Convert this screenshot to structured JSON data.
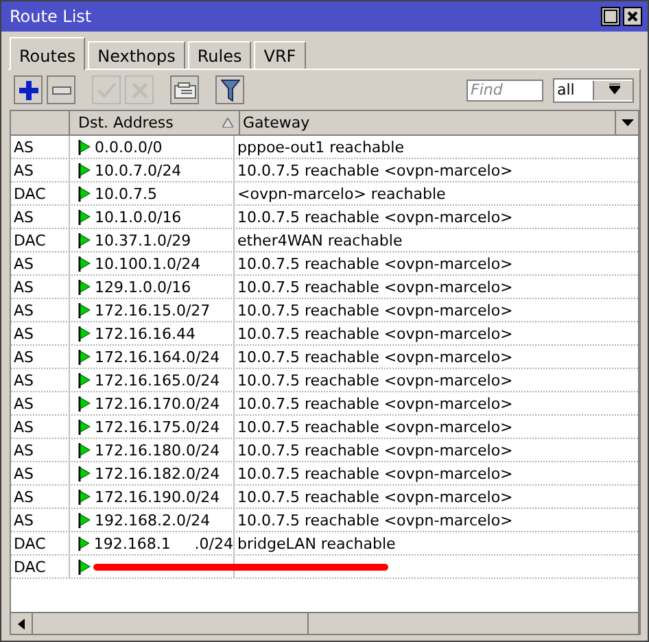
{
  "window": {
    "title": "Route List"
  },
  "tabs": [
    {
      "label": "Routes",
      "selected": true
    },
    {
      "label": "Nexthops",
      "selected": false
    },
    {
      "label": "Rules",
      "selected": false
    },
    {
      "label": "VRF",
      "selected": false
    }
  ],
  "toolbar": {
    "buttons": [
      {
        "kind": "add",
        "disabled": false
      },
      {
        "kind": "remove",
        "disabled": false
      },
      {
        "kind": "enable",
        "disabled": true
      },
      {
        "kind": "disable",
        "disabled": true
      },
      {
        "kind": "comment",
        "disabled": false
      },
      {
        "kind": "filter",
        "disabled": false
      }
    ],
    "search": {
      "placeholder": "Find"
    },
    "filter_select": {
      "value": "all"
    }
  },
  "table": {
    "columns": [
      {
        "label": "Dst. Address"
      },
      {
        "label": "Gateway"
      }
    ],
    "rows": [
      {
        "type": "AS",
        "dst": "0.0.0.0/0",
        "gateway": "pppoe-out1 reachable"
      },
      {
        "type": "AS",
        "dst": "10.0.7.0/24",
        "gateway": "10.0.7.5 reachable <ovpn-marcelo>"
      },
      {
        "type": "DAC",
        "dst": "10.0.7.5",
        "gateway": "<ovpn-marcelo> reachable"
      },
      {
        "type": "AS",
        "dst": "10.1.0.0/16",
        "gateway": "10.0.7.5 reachable <ovpn-marcelo>"
      },
      {
        "type": "DAC",
        "dst": "10.37.1.0/29",
        "gateway": "ether4WAN reachable"
      },
      {
        "type": "AS",
        "dst": "10.100.1.0/24",
        "gateway": "10.0.7.5 reachable <ovpn-marcelo>"
      },
      {
        "type": "AS",
        "dst": "129.1.0.0/16",
        "gateway": "10.0.7.5 reachable <ovpn-marcelo>"
      },
      {
        "type": "AS",
        "dst": "172.16.15.0/27",
        "gateway": "10.0.7.5 reachable <ovpn-marcelo>"
      },
      {
        "type": "AS",
        "dst": "172.16.16.44",
        "gateway": "10.0.7.5 reachable <ovpn-marcelo>"
      },
      {
        "type": "AS",
        "dst": "172.16.164.0/24",
        "gateway": "10.0.7.5 reachable <ovpn-marcelo>"
      },
      {
        "type": "AS",
        "dst": "172.16.165.0/24",
        "gateway": "10.0.7.5 reachable <ovpn-marcelo>"
      },
      {
        "type": "AS",
        "dst": "172.16.170.0/24",
        "gateway": "10.0.7.5 reachable <ovpn-marcelo>"
      },
      {
        "type": "AS",
        "dst": "172.16.175.0/24",
        "gateway": "10.0.7.5 reachable <ovpn-marcelo>"
      },
      {
        "type": "AS",
        "dst": "172.16.180.0/24",
        "gateway": "10.0.7.5 reachable <ovpn-marcelo>"
      },
      {
        "type": "AS",
        "dst": "172.16.182.0/24",
        "gateway": "10.0.7.5 reachable <ovpn-marcelo>"
      },
      {
        "type": "AS",
        "dst": "172.16.190.0/24",
        "gateway": "10.0.7.5 reachable <ovpn-marcelo>"
      },
      {
        "type": "AS",
        "dst": "192.168.2.0/24",
        "gateway": "10.0.7.5 reachable <ovpn-marcelo>"
      },
      {
        "type": "DAC",
        "dst": "192.168.1     .0/24",
        "gateway": "bridgeLAN reachable"
      },
      {
        "type": "DAC",
        "redacted": true
      }
    ]
  }
}
